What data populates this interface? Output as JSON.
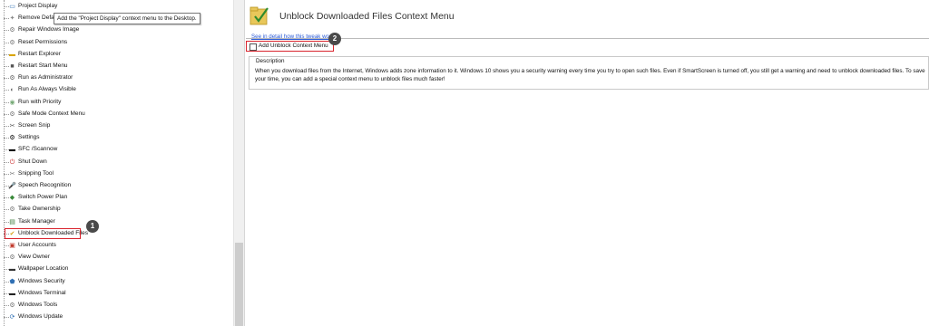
{
  "tooltip": "Add the \"Project Display\" context menu to the Desktop.",
  "tree": {
    "items": [
      {
        "label": "Project Display",
        "icon": "monitor-icon",
        "glyph": "▭",
        "color": "#2f6fb3"
      },
      {
        "label": "Remove Default",
        "icon": "remove-icon",
        "glyph": "✦",
        "color": "#888"
      },
      {
        "label": "Repair Windows Image",
        "icon": "repair-icon",
        "glyph": "⚙",
        "color": "#777"
      },
      {
        "label": "Reset Permissions",
        "icon": "permissions-icon",
        "glyph": "⚙",
        "color": "#777"
      },
      {
        "label": "Restart Explorer",
        "icon": "explorer-icon",
        "glyph": "▬",
        "color": "#d9a400"
      },
      {
        "label": "Restart Start Menu",
        "icon": "startmenu-icon",
        "glyph": "■",
        "color": "#555"
      },
      {
        "label": "Run as Administrator",
        "icon": "admin-icon",
        "glyph": "⚙",
        "color": "#666"
      },
      {
        "label": "Run As Always Visible",
        "icon": "always-visible-icon",
        "glyph": "◐",
        "color": "#666"
      },
      {
        "label": "Run with Priority",
        "icon": "priority-icon",
        "glyph": "◉",
        "color": "#7a7"
      },
      {
        "label": "Safe Mode Context Menu",
        "icon": "safemode-icon",
        "glyph": "⚙",
        "color": "#777"
      },
      {
        "label": "Screen Snip",
        "icon": "scissors-icon",
        "glyph": "✂",
        "color": "#555"
      },
      {
        "label": "Settings",
        "icon": "gear-icon",
        "glyph": "⚙",
        "color": "#000"
      },
      {
        "label": "SFC /Scannow",
        "icon": "console-icon",
        "glyph": "▬",
        "color": "#000"
      },
      {
        "label": "Shut Down",
        "icon": "power-icon",
        "glyph": "⏻",
        "color": "#c33"
      },
      {
        "label": "Snipping Tool",
        "icon": "snipping-icon",
        "glyph": "✂",
        "color": "#777"
      },
      {
        "label": "Speech Recognition",
        "icon": "microphone-icon",
        "glyph": "🎤",
        "color": "#777"
      },
      {
        "label": "Switch Power Plan",
        "icon": "powerplan-icon",
        "glyph": "◆",
        "color": "#3a8a3a"
      },
      {
        "label": "Take Ownership",
        "icon": "ownership-icon",
        "glyph": "⚙",
        "color": "#777"
      },
      {
        "label": "Task Manager",
        "icon": "taskmanager-icon",
        "glyph": "▤",
        "color": "#3a7a3a"
      },
      {
        "label": "Unblock Downloaded Files",
        "icon": "unblock-icon",
        "glyph": "✔",
        "color": "#d6a21e"
      },
      {
        "label": "User Accounts",
        "icon": "user-icon",
        "glyph": "▣",
        "color": "#c0392b"
      },
      {
        "label": "View Owner",
        "icon": "owner-icon",
        "glyph": "⚙",
        "color": "#777"
      },
      {
        "label": "Wallpaper Location",
        "icon": "wallpaper-icon",
        "glyph": "▬",
        "color": "#333"
      },
      {
        "label": "Windows Security",
        "icon": "shield-icon",
        "glyph": "⬟",
        "color": "#2f6fb3"
      },
      {
        "label": "Windows Terminal",
        "icon": "terminal-icon",
        "glyph": "▬",
        "color": "#222"
      },
      {
        "label": "Windows Tools",
        "icon": "tools-icon",
        "glyph": "⚙",
        "color": "#777"
      },
      {
        "label": "Windows Update",
        "icon": "update-icon",
        "glyph": "⟳",
        "color": "#2f6fb3"
      }
    ]
  },
  "badges": {
    "one": "1",
    "two": "2"
  },
  "main": {
    "title": "Unblock Downloaded Files Context Menu",
    "detail_link": "See in detail how this tweak works",
    "checkbox_label": "Add Unblock Context Menu",
    "checked": false,
    "description_title": "Description",
    "description_text": "When you download files from the Internet, Windows adds zone information to it. Windows 10 shows you a security warning every time you try to open such files. Even if SmartScreen is turned off, you still get a warning and need to unblock downloaded files. To save your time, you can add a special context menu to unblock files much faster!"
  },
  "colors": {
    "highlight": "#d9242e",
    "link": "#2a5ad6",
    "badge": "#4a4a4a"
  }
}
